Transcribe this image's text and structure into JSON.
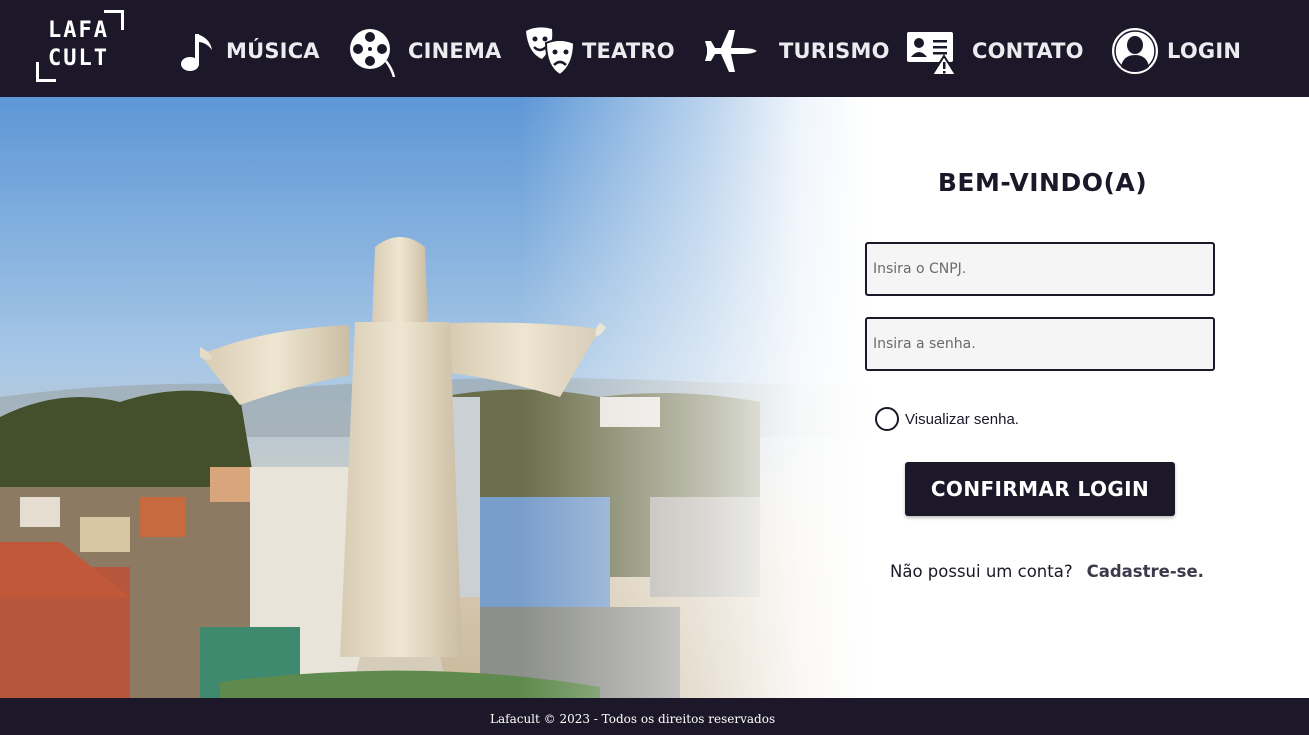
{
  "nav": {
    "logo": {
      "line1": "LAFA",
      "line2": "CULT"
    },
    "items": [
      {
        "label": "MÚSICA",
        "icon": "music-note-icon"
      },
      {
        "label": "CINEMA",
        "icon": "film-reel-icon"
      },
      {
        "label": "TEATRO",
        "icon": "theater-masks-icon"
      },
      {
        "label": "TURISMO",
        "icon": "airplane-icon"
      },
      {
        "label": "CONTATO",
        "icon": "contact-card-icon"
      },
      {
        "label": "LOGIN",
        "icon": "user-avatar-icon"
      }
    ]
  },
  "login": {
    "title": "BEM-VINDO(A)",
    "cnpj_placeholder": "Insira o CNPJ.",
    "password_placeholder": "Insira a senha.",
    "show_password_label": "Visualizar senha.",
    "submit_label": "CONFIRMAR LOGIN",
    "signup_prompt": "Não possui um conta?",
    "signup_link": "Cadastre-se."
  },
  "footer": {
    "text": "Lafacult © 2023 - Todos os direitos reservados"
  },
  "colors": {
    "primary": "#1c1829",
    "field_bg": "#f5f5f5",
    "white": "#ffffff"
  }
}
